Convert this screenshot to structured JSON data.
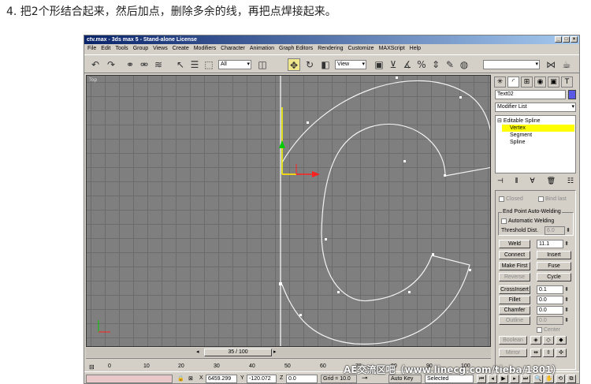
{
  "caption": "4. 把2个形结合起来，然后加点，删除多余的线，再把点焊接起来。",
  "window": {
    "title": "ctv.max - 3ds max 5 - Stand-alone License",
    "menu": [
      "File",
      "Edit",
      "Tools",
      "Group",
      "Views",
      "Create",
      "Modifiers",
      "Character",
      "Animation",
      "Graph Editors",
      "Rendering",
      "Customize",
      "MAXScript",
      "Help"
    ],
    "selection_filter": "All",
    "ref_coord": "View"
  },
  "viewport": {
    "label": "Top",
    "grid_color": "#6c6c6c",
    "bg_color": "#7f7f7f",
    "spline_color": "#f2f2f2"
  },
  "timeline": {
    "frame": "35 / 100",
    "ticks": [
      "0",
      "10",
      "20",
      "30",
      "40",
      "50",
      "60",
      "70",
      "80",
      "90",
      "100"
    ]
  },
  "status": {
    "x_label": "X",
    "x": "6459.299",
    "y_label": "Y",
    "y": "-120.072",
    "z_label": "Z",
    "z": "0.0",
    "grid": "Grid = 10.0",
    "autokey": "Auto Key",
    "selected": "Selected"
  },
  "panel": {
    "object_name": "Text02",
    "modifier_list": "Modifier List",
    "stack": [
      {
        "label": "Editable Spline",
        "level": 0
      },
      {
        "label": "Vertex",
        "level": 1
      },
      {
        "label": "Segment",
        "level": 1
      },
      {
        "label": "Spline",
        "level": 1
      }
    ],
    "closed": "Closed",
    "bind_last": "Bind last",
    "autoweld_group": "End Point Auto-Welding",
    "automatic_welding": "Automatic Welding",
    "threshold_label": "Threshold Dist.",
    "threshold_value": "6.0",
    "weld": "Weld",
    "weld_value": "11.1",
    "connect": "Connect",
    "insert": "Insert",
    "make_first": "Make First",
    "fuse": "Fuse",
    "reverse": "Reverse",
    "cycle": "Cycle",
    "crossinsert": "CrossInsert",
    "crossinsert_value": "0.1",
    "fillet": "Fillet",
    "fillet_value": "0.0",
    "chamfer": "Chamfer",
    "chamfer_value": "0.0",
    "outline": "Outline",
    "outline_value": "0.0",
    "center": "Center",
    "boolean": "Boolean",
    "mirror": "Mirror"
  },
  "watermark": "AE交流区吧（www.linecg.com/tieba/1801）"
}
